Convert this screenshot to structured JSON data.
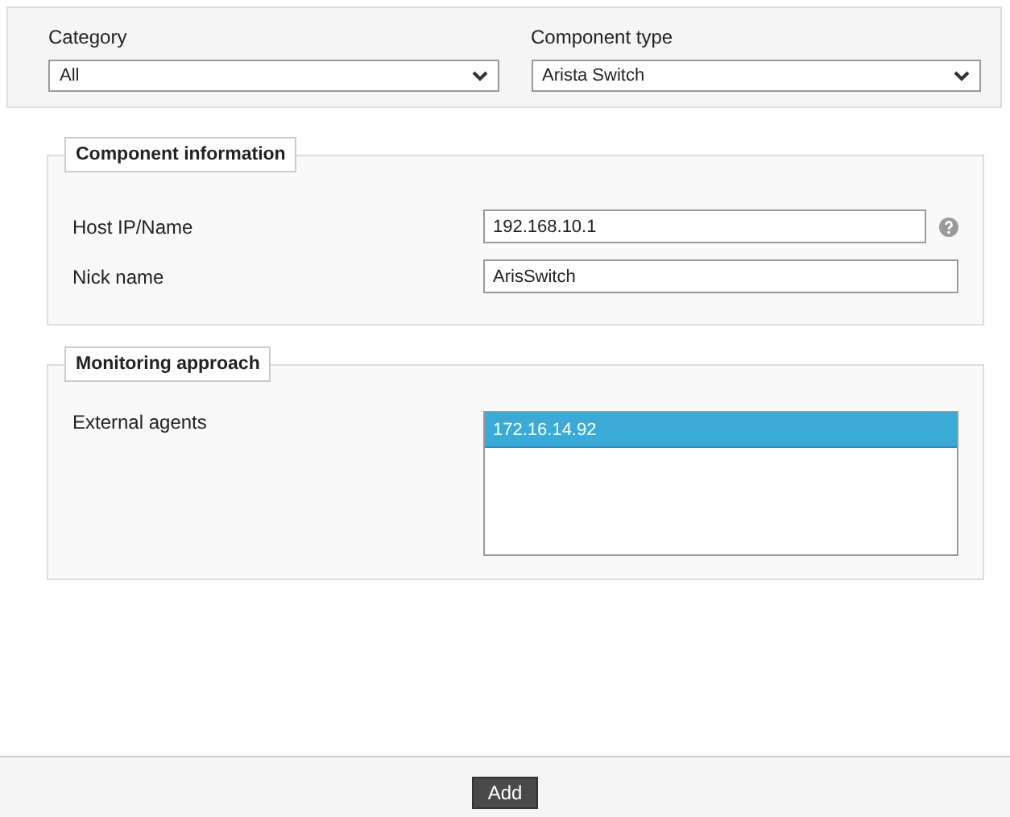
{
  "filters": [
    {
      "label": "Category",
      "value": "All"
    },
    {
      "label": "Component type",
      "value": "Arista Switch"
    }
  ],
  "sections": [
    {
      "title": "Component information",
      "kind": "fields",
      "fields": [
        {
          "label": "Host IP/Name",
          "value": "192.168.10.1",
          "help": true
        },
        {
          "label": "Nick name",
          "value": "ArisSwitch",
          "help": false
        }
      ]
    },
    {
      "title": "Monitoring approach",
      "kind": "list",
      "label": "External agents",
      "items": [
        {
          "text": "172.16.14.92",
          "selected": true
        }
      ]
    }
  ],
  "buttons": [
    "Add"
  ]
}
